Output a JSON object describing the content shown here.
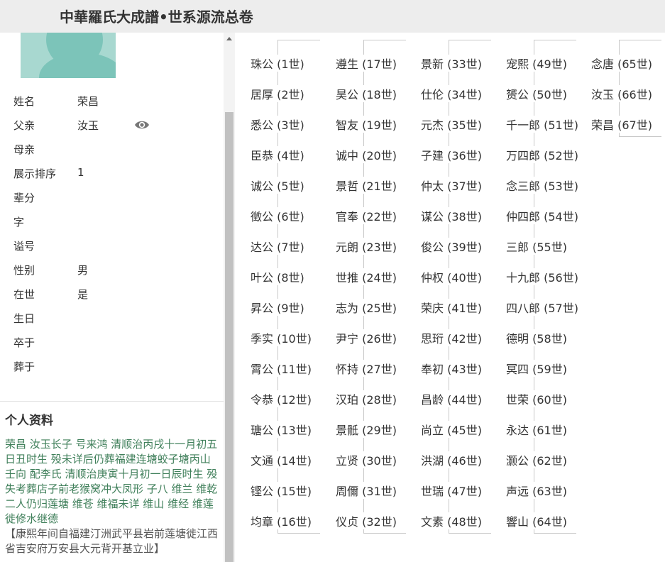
{
  "header": {
    "title": "中華羅氏大成譜•世系源流总卷"
  },
  "person": {
    "fields": [
      {
        "label": "姓名",
        "value": "荣昌"
      },
      {
        "label": "父亲",
        "value": "汝玉"
      },
      {
        "label": "母亲",
        "value": ""
      },
      {
        "label": "展示排序",
        "value": "1"
      },
      {
        "label": "辈分",
        "value": ""
      },
      {
        "label": "字",
        "value": ""
      },
      {
        "label": "谥号",
        "value": ""
      },
      {
        "label": "性别",
        "value": "男"
      },
      {
        "label": "在世",
        "value": "是"
      },
      {
        "label": "生日",
        "value": ""
      },
      {
        "label": "卒于",
        "value": ""
      },
      {
        "label": "葬于",
        "value": ""
      }
    ]
  },
  "profile": {
    "title": "个人资料",
    "text": "荣昌 汝玉长子 号来鸿 清顺治丙戌十一月初五日丑时生 殁未详后仍葬福建连塘蛟子塘丙山壬向 配李氏 清顺治庚寅十月初一日辰时生 殁失考葬店子前老猴窝冲大凤形 子八 维兰 维乾二人仍归莲塘 维苍 维福未详 维山 维经 维莲徙修水继德",
    "source": "【康熙年间自福建汀洲武平县岩前莲塘徙江西省吉安府万安县大元背开基立业】"
  },
  "generations": [
    [
      "珠公 (1世)",
      "居厚 (2世)",
      "悉公 (3世)",
      "臣恭 (4世)",
      "诚公 (5世)",
      "徵公 (6世)",
      "达公 (7世)",
      "叶公 (8世)",
      "昇公 (9世)",
      "季实 (10世)",
      "霄公 (11世)",
      "令恭 (12世)",
      "瑭公 (13世)",
      "文通 (14世)",
      "铿公 (15世)",
      "均章 (16世)"
    ],
    [
      "遵生 (17世)",
      "昊公 (18世)",
      "智友 (19世)",
      "诚中 (20世)",
      "景哲 (21世)",
      "官奉 (22世)",
      "元朗 (23世)",
      "世推 (24世)",
      "志为 (25世)",
      "尹宁 (26世)",
      "怀持 (27世)",
      "汉珀 (28世)",
      "景骶 (29世)",
      "立贤 (30世)",
      "周儞 (31世)",
      "仪贞 (32世)"
    ],
    [
      "景新 (33世)",
      "仕伦 (34世)",
      "元杰 (35世)",
      "子建 (36世)",
      "仲太 (37世)",
      "谋公 (38世)",
      "俊公 (39世)",
      "仲权 (40世)",
      "荣庆 (41世)",
      "思珩 (42世)",
      "奉初 (43世)",
      "昌龄 (44世)",
      "尚立 (45世)",
      "洪湖 (46世)",
      "世瑞 (47世)",
      "文素 (48世)"
    ],
    [
      "宠熙 (49世)",
      "赟公 (50世)",
      "千一郎 (51世)",
      "万四郎 (52世)",
      "念三郎 (53世)",
      "仲四郎 (54世)",
      "三郎 (55世)",
      "十九郎 (56世)",
      "四八郎 (57世)",
      "德明 (58世)",
      "冥四 (59世)",
      "世荣 (60世)",
      "永达 (61世)",
      "灏公 (62世)",
      "声远 (63世)",
      "響山 (64世)"
    ],
    [
      "念唐 (65世)",
      "汝玉 (66世)",
      "荣昌 (67世)"
    ]
  ]
}
